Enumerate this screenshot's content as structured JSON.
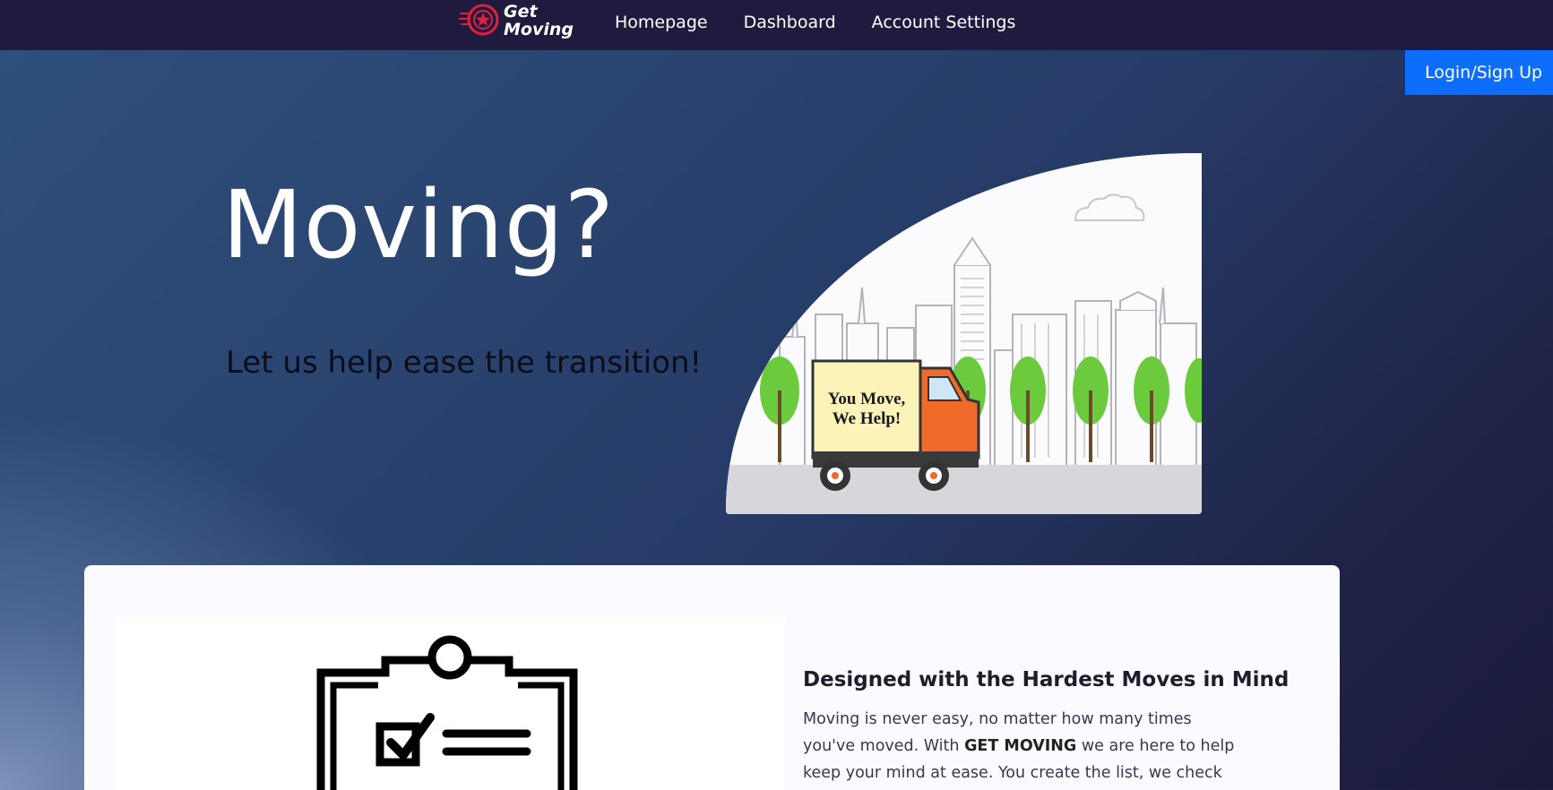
{
  "brand": {
    "name_line1": "Get",
    "name_line2": "Moving",
    "logo_icon": "wheel-icon",
    "accent_color": "#e0203c"
  },
  "nav": {
    "links": [
      "Homepage",
      "Dashboard",
      "Account Settings"
    ],
    "login_label": "Login/Sign Up",
    "background": "#211a3f",
    "login_color": "#0d6efd"
  },
  "hero": {
    "title": "Moving?",
    "subtitle": "Let us help ease the transition!",
    "truck_sign_line1": "You Move,",
    "truck_sign_line2": "We Help!"
  },
  "feature": {
    "icon": "clipboard-checklist-icon",
    "title": "Designed with the Hardest Moves in Mind",
    "text_before": "Moving is never easy, no matter how many times you've moved. With ",
    "text_brand": "GET MOVING",
    "text_after": " we are here to help keep your mind at ease. You create the list, we check the boxes."
  }
}
